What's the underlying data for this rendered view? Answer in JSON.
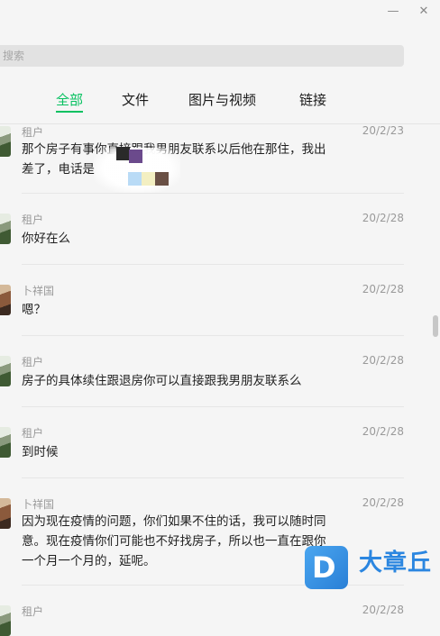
{
  "window": {
    "minimize_glyph": "—",
    "close_glyph": "✕"
  },
  "search": {
    "placeholder": "搜索"
  },
  "tabs": [
    {
      "label": "全部",
      "active": true
    },
    {
      "label": "文件",
      "active": false
    },
    {
      "label": "图片与视频",
      "active": false
    },
    {
      "label": "链接",
      "active": false
    }
  ],
  "messages": [
    {
      "sender": "租户",
      "date": "20/2/23",
      "text_line1": "那个房子有事你直接跟我男朋友联系以后他在那住，我出",
      "text_line2": "差了，电话是"
    },
    {
      "sender": "租户",
      "date": "20/2/28",
      "text": "你好在么"
    },
    {
      "sender": "卜祥国",
      "date": "20/2/28",
      "text": "嗯？"
    },
    {
      "sender": "租户",
      "date": "20/2/28",
      "text": "房子的具体续住跟退房你可以直接跟我男朋友联系么"
    },
    {
      "sender": "租户",
      "date": "20/2/28",
      "text": "到时候"
    },
    {
      "sender": "卜祥国",
      "date": "20/2/28",
      "text_line1": "因为现在疫情的问题，你们如果不住的话，我可以随时同",
      "text_line2": "意。现在疫情你们可能也不好找房子，所以也一直在跟你",
      "text_line3": "一个月一个月的，延呢。"
    },
    {
      "sender": "租户",
      "date": "20/2/28"
    }
  ],
  "watermark": {
    "letter": "D",
    "brand": "大章丘"
  },
  "colors": {
    "accent": "#07c160",
    "watermark": "#2b86e0"
  }
}
